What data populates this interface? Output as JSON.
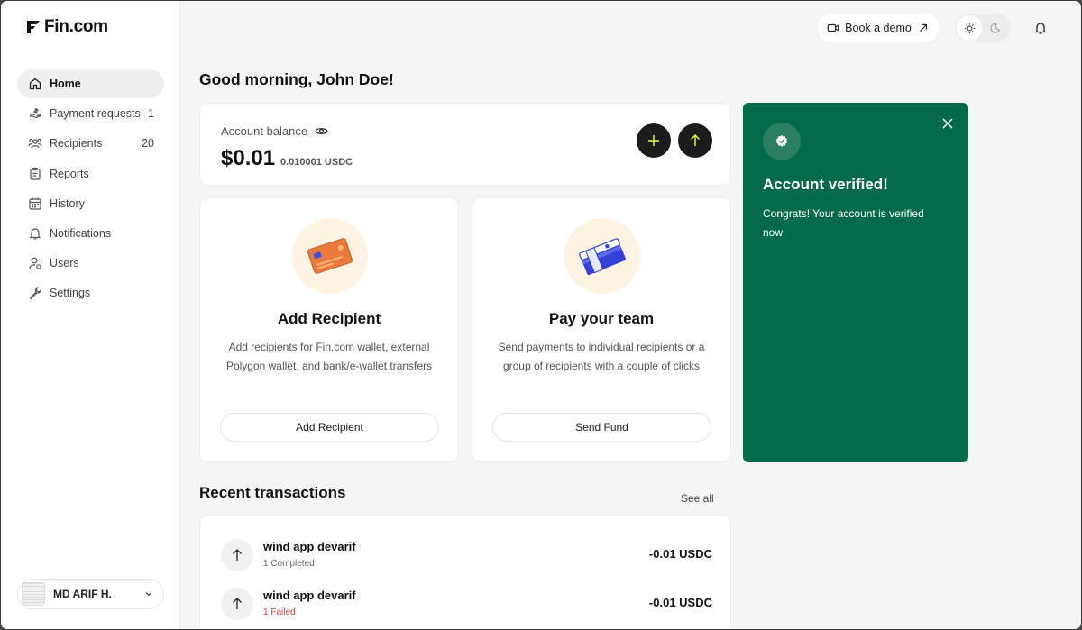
{
  "brand": {
    "name": "Fin.com"
  },
  "sidebar": {
    "items": [
      {
        "label": "Home",
        "icon": "home-icon",
        "count": "",
        "active": true
      },
      {
        "label": "Payment requests",
        "icon": "payment-request-icon",
        "count": "1"
      },
      {
        "label": "Recipients",
        "icon": "users-group-icon",
        "count": "20"
      },
      {
        "label": "Reports",
        "icon": "report-icon",
        "count": ""
      },
      {
        "label": "History",
        "icon": "calendar-icon",
        "count": ""
      },
      {
        "label": "Notifications",
        "icon": "bell-icon",
        "count": ""
      },
      {
        "label": "Users",
        "icon": "user-icon",
        "count": ""
      },
      {
        "label": "Settings",
        "icon": "wrench-icon",
        "count": ""
      }
    ],
    "user": {
      "name": "MD ARIF H."
    }
  },
  "topbar": {
    "book_demo_label": "Book a demo"
  },
  "greeting": "Good morning, John Doe!",
  "balance": {
    "label": "Account balance",
    "amount": "$0.01",
    "sub_amount": "0.010001 USDC"
  },
  "cards": [
    {
      "title": "Add Recipient",
      "description": "Add recipients for Fin.com wallet, external Polygon wallet, and bank/e-wallet transfers",
      "button": "Add Recipient",
      "icon": "credit-card-illustration"
    },
    {
      "title": "Pay your team",
      "description": "Send payments to individual recipients or a group of recipients with a couple of clicks",
      "button": "Send Fund",
      "icon": "money-stack-illustration"
    }
  ],
  "verified": {
    "title": "Account verified!",
    "text": "Congrats! Your account is verified now"
  },
  "recent": {
    "title": "Recent transactions",
    "see_all": "See all",
    "transactions": [
      {
        "name": "wind app devarif",
        "status": "1 Completed",
        "amount": "-0.01 USDC",
        "status_type": "completed"
      },
      {
        "name": "wind app devarif",
        "status": "1 Failed",
        "amount": "-0.01 USDC",
        "status_type": "failed"
      }
    ]
  },
  "colors": {
    "verified_bg": "#046b4a",
    "failed": "#d83a34",
    "accent_icon": "#e9ff3a"
  }
}
